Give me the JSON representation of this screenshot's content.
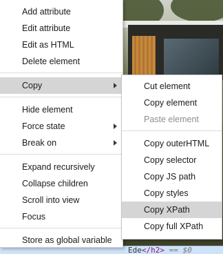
{
  "main_menu": {
    "items": [
      {
        "label": "Add attribute"
      },
      {
        "label": "Edit attribute"
      },
      {
        "label": "Edit as HTML"
      },
      {
        "label": "Delete element"
      },
      {
        "label": "Copy"
      },
      {
        "label": "Hide element"
      },
      {
        "label": "Force state"
      },
      {
        "label": "Break on"
      },
      {
        "label": "Expand recursively"
      },
      {
        "label": "Collapse children"
      },
      {
        "label": "Scroll into view"
      },
      {
        "label": "Focus"
      },
      {
        "label": "Store as global variable"
      }
    ]
  },
  "copy_submenu": {
    "items": [
      {
        "label": "Cut element"
      },
      {
        "label": "Copy element"
      },
      {
        "label": "Paste element"
      },
      {
        "label": "Copy outerHTML"
      },
      {
        "label": "Copy selector"
      },
      {
        "label": "Copy JS path"
      },
      {
        "label": "Copy styles"
      },
      {
        "label": "Copy XPath"
      },
      {
        "label": "Copy full XPath"
      }
    ]
  },
  "devtools": {
    "text": "Ede",
    "closing_tag": "</h2>",
    "eq": "== $0"
  },
  "colors": {
    "selected_bg": "#d5d5d5",
    "disabled_text": "#8e8e8e",
    "highlight_row": "#cfe3f8"
  }
}
